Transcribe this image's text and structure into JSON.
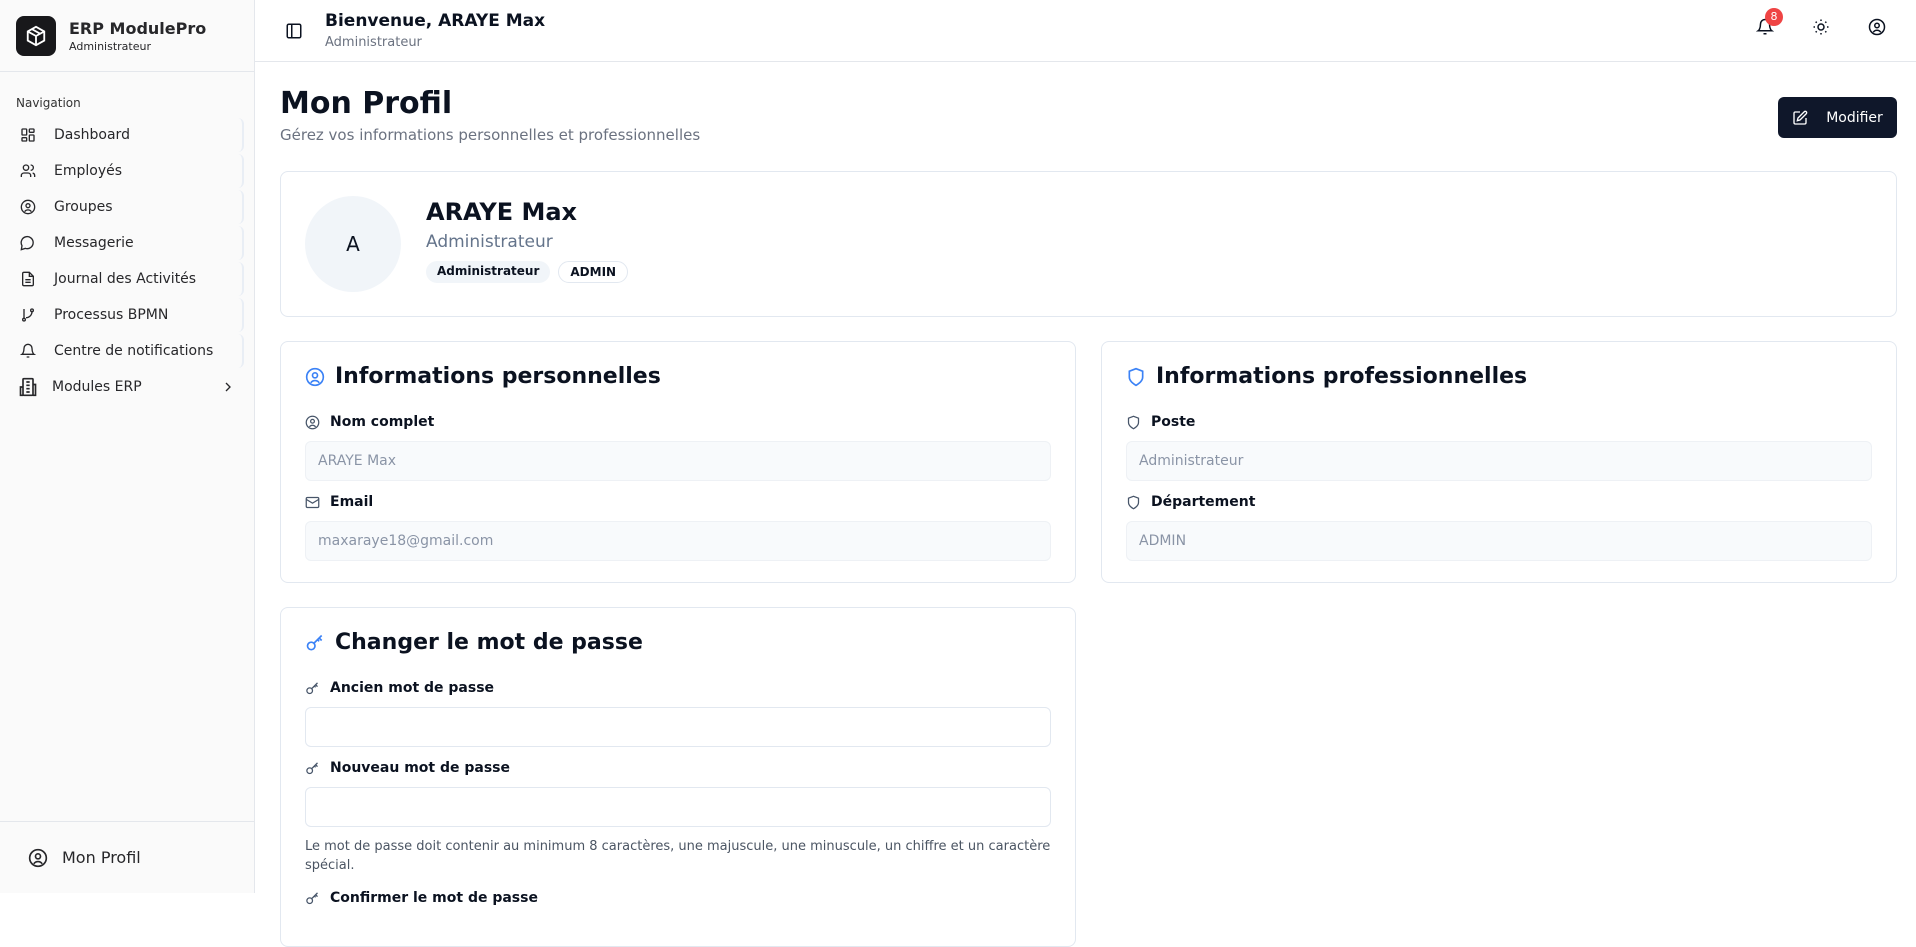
{
  "brand": {
    "title": "ERP ModulePro",
    "subtitle": "Administrateur"
  },
  "sidebar": {
    "section": "Navigation",
    "items": [
      {
        "label": "Dashboard",
        "icon": "dashboard-icon"
      },
      {
        "label": "Employés",
        "icon": "users-icon"
      },
      {
        "label": "Groupes",
        "icon": "user-circle-icon"
      },
      {
        "label": "Messagerie",
        "icon": "message-icon"
      },
      {
        "label": "Journal des Activités",
        "icon": "file-text-icon"
      },
      {
        "label": "Processus BPMN",
        "icon": "git-branch-icon"
      },
      {
        "label": "Centre de notifications",
        "icon": "bell-icon"
      },
      {
        "label": "Modules ERP",
        "icon": "building-icon"
      }
    ],
    "footer": "Mon Profil"
  },
  "header": {
    "title": "Bienvenue, ARAYE Max",
    "subtitle": "Administrateur",
    "notification_count": "8"
  },
  "page": {
    "title": "Mon Profil",
    "subtitle": "Gérez vos informations personnelles et professionnelles",
    "edit_label": "Modifier"
  },
  "profile": {
    "initial": "A",
    "name": "ARAYE Max",
    "role": "Administrateur",
    "chips": [
      "Administrateur",
      "ADMIN"
    ]
  },
  "personal": {
    "title": "Informations personnelles",
    "name_label": "Nom complet",
    "name_value": "ARAYE Max",
    "email_label": "Email",
    "email_value": "maxaraye18@gmail.com"
  },
  "professional": {
    "title": "Informations professionnelles",
    "poste_label": "Poste",
    "poste_value": "Administrateur",
    "dept_label": "Département",
    "dept_value": "ADMIN"
  },
  "password": {
    "title": "Changer le mot de passe",
    "old_label": "Ancien mot de passe",
    "new_label": "Nouveau mot de passe",
    "hint": "Le mot de passe doit contenir au minimum 8 caractères, une majuscule, une minuscule, un chiffre et un caractère spécial.",
    "confirm_label": "Confirmer le mot de passe"
  },
  "colors": {
    "accent": "#3b82f6",
    "primary": "#0f172a",
    "badge": "#ef4444"
  }
}
